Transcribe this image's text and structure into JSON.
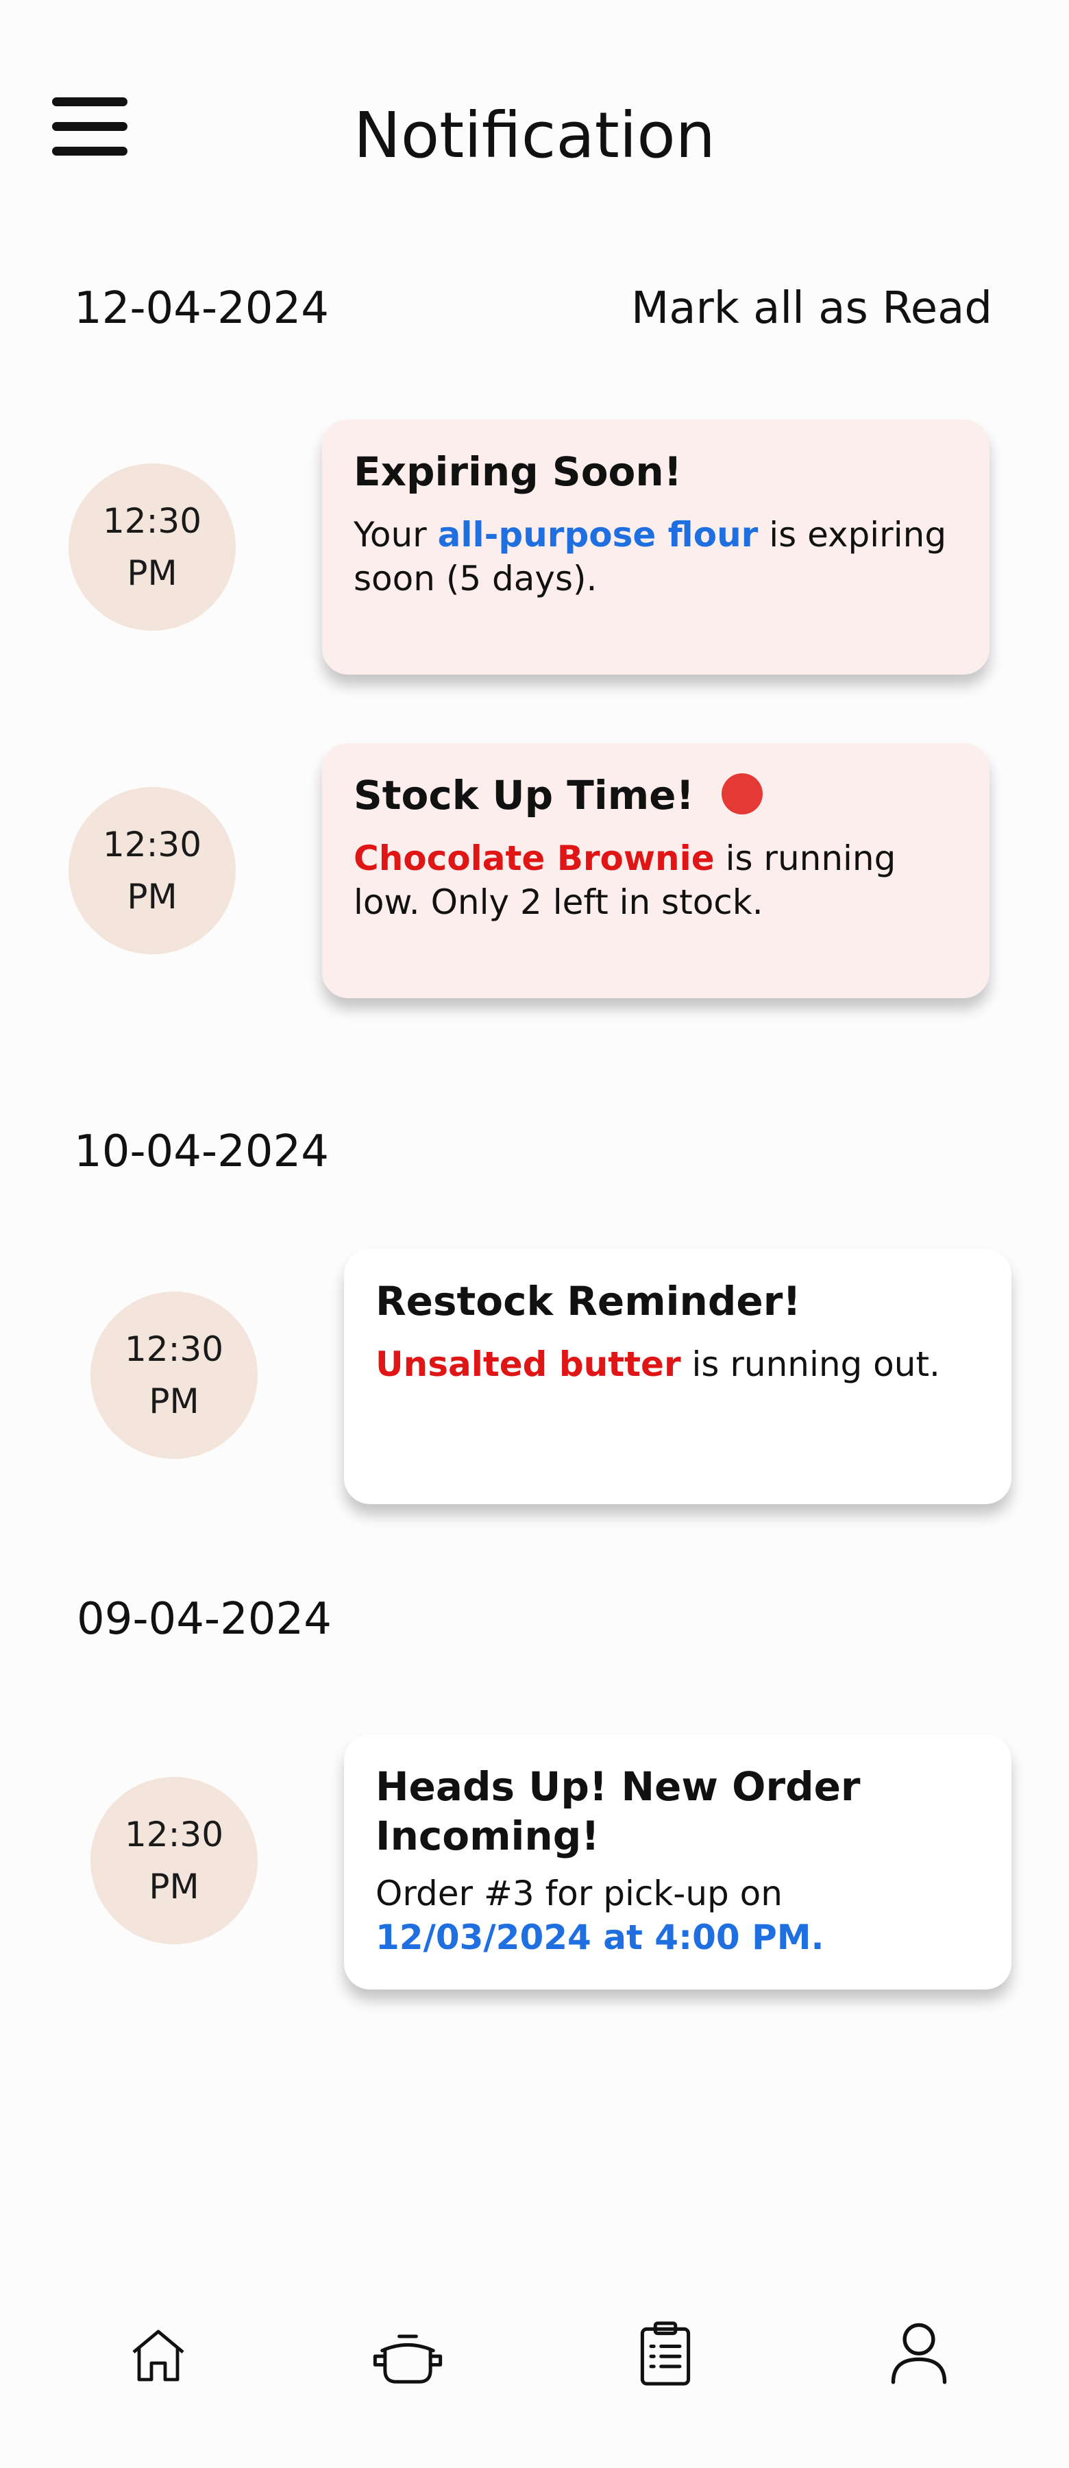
{
  "header": {
    "title": "Notification",
    "menu_icon": "hamburger-menu-icon"
  },
  "actions": {
    "mark_all_read": "Mark all as Read"
  },
  "groups": [
    {
      "date": "12-04-2024",
      "notifications": [
        {
          "time_hour": "12:30",
          "time_period": "PM",
          "title": "Expiring Soon!",
          "body_prefix": "Your ",
          "body_highlight": "all-purpose flour",
          "body_suffix": " is expiring soon (5 days).",
          "highlight_color": "#1f6fe0",
          "background": "#fdeeee",
          "unread": false
        },
        {
          "time_hour": "12:30",
          "time_period": "PM",
          "title": "Stock Up Time!",
          "body_prefix": "",
          "body_highlight": "Chocolate Brownie",
          "body_suffix": " is running low. Only 2 left in stock.",
          "highlight_color": "#e01515",
          "background": "#fdeeee",
          "unread": true
        }
      ]
    },
    {
      "date": "10-04-2024",
      "notifications": [
        {
          "time_hour": "12:30",
          "time_period": "PM",
          "title": "Restock Reminder!",
          "body_prefix": "",
          "body_highlight": "Unsalted butter",
          "body_suffix": " is running out.",
          "highlight_color": "#e01515",
          "background": "#ffffff",
          "unread": false
        }
      ]
    },
    {
      "date": "09-04-2024",
      "notifications": [
        {
          "time_hour": "12:30",
          "time_period": "PM",
          "title": "Heads Up! New Order Incoming!",
          "body_prefix": "Order #3 for pick-up on ",
          "body_highlight": "12/03/2024 at 4:00 PM.",
          "body_suffix": "",
          "highlight_color": "#1f6fe0",
          "background": "#ffffff",
          "unread": false
        }
      ]
    }
  ],
  "bottom_nav": [
    {
      "icon": "home-icon"
    },
    {
      "icon": "cooking-pot-icon"
    },
    {
      "icon": "clipboard-list-icon"
    },
    {
      "icon": "user-profile-icon"
    }
  ],
  "colors": {
    "accent_blue": "#1f6fe0",
    "accent_red": "#e01515",
    "unread_dot": "#e53935",
    "time_bubble": "#f3e4dc",
    "card_pink": "#fdeeee"
  }
}
